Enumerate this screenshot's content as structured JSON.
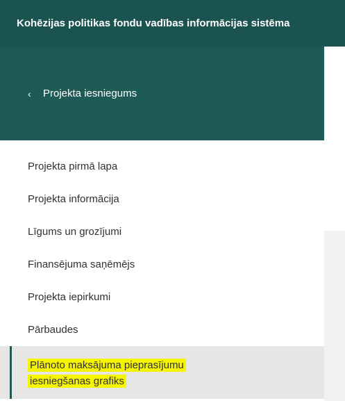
{
  "app": {
    "title": "Kohēzijas politikas fondu vadības informācijas sistēma"
  },
  "sidebar": {
    "back_label": "Projekta iesniegums",
    "items": [
      {
        "label": "Projekta pirmā lapa"
      },
      {
        "label": "Projekta informācija"
      },
      {
        "label": "Līgums un grozījumi"
      },
      {
        "label": "Finansējuma saņēmējs"
      },
      {
        "label": "Projekta iepirkumi"
      },
      {
        "label": "Pārbaudes"
      }
    ],
    "active_item": {
      "line1": "Plānoto maksājuma pieprasījumu",
      "line2": "iesniegšanas grafiks"
    }
  },
  "colors": {
    "topbar": "#1b5350",
    "sidebar_header": "#1e5a56",
    "highlight": "#f5f500",
    "active_bg": "#e6e6e6"
  },
  "icons": {
    "back": "chevron-left-icon"
  }
}
